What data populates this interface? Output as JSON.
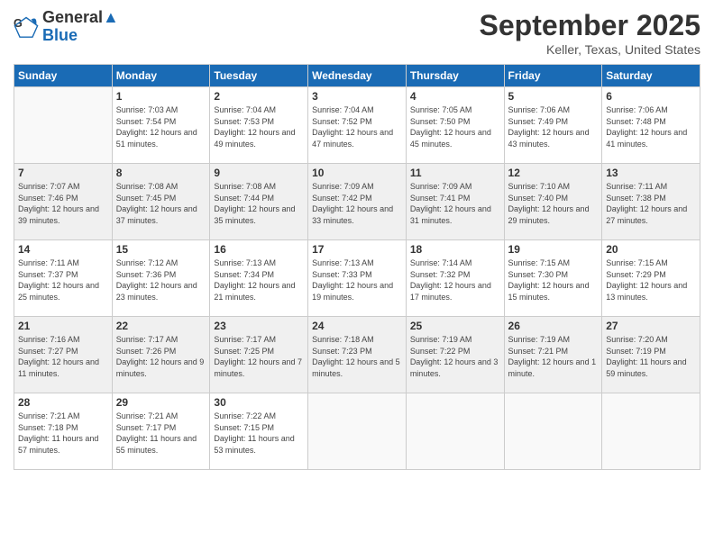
{
  "logo": {
    "line1": "General",
    "line2": "Blue"
  },
  "header": {
    "month": "September 2025",
    "location": "Keller, Texas, United States"
  },
  "weekdays": [
    "Sunday",
    "Monday",
    "Tuesday",
    "Wednesday",
    "Thursday",
    "Friday",
    "Saturday"
  ],
  "weeks": [
    [
      {
        "day": "",
        "sunrise": "",
        "sunset": "",
        "daylight": ""
      },
      {
        "day": "1",
        "sunrise": "Sunrise: 7:03 AM",
        "sunset": "Sunset: 7:54 PM",
        "daylight": "Daylight: 12 hours and 51 minutes."
      },
      {
        "day": "2",
        "sunrise": "Sunrise: 7:04 AM",
        "sunset": "Sunset: 7:53 PM",
        "daylight": "Daylight: 12 hours and 49 minutes."
      },
      {
        "day": "3",
        "sunrise": "Sunrise: 7:04 AM",
        "sunset": "Sunset: 7:52 PM",
        "daylight": "Daylight: 12 hours and 47 minutes."
      },
      {
        "day": "4",
        "sunrise": "Sunrise: 7:05 AM",
        "sunset": "Sunset: 7:50 PM",
        "daylight": "Daylight: 12 hours and 45 minutes."
      },
      {
        "day": "5",
        "sunrise": "Sunrise: 7:06 AM",
        "sunset": "Sunset: 7:49 PM",
        "daylight": "Daylight: 12 hours and 43 minutes."
      },
      {
        "day": "6",
        "sunrise": "Sunrise: 7:06 AM",
        "sunset": "Sunset: 7:48 PM",
        "daylight": "Daylight: 12 hours and 41 minutes."
      }
    ],
    [
      {
        "day": "7",
        "sunrise": "Sunrise: 7:07 AM",
        "sunset": "Sunset: 7:46 PM",
        "daylight": "Daylight: 12 hours and 39 minutes."
      },
      {
        "day": "8",
        "sunrise": "Sunrise: 7:08 AM",
        "sunset": "Sunset: 7:45 PM",
        "daylight": "Daylight: 12 hours and 37 minutes."
      },
      {
        "day": "9",
        "sunrise": "Sunrise: 7:08 AM",
        "sunset": "Sunset: 7:44 PM",
        "daylight": "Daylight: 12 hours and 35 minutes."
      },
      {
        "day": "10",
        "sunrise": "Sunrise: 7:09 AM",
        "sunset": "Sunset: 7:42 PM",
        "daylight": "Daylight: 12 hours and 33 minutes."
      },
      {
        "day": "11",
        "sunrise": "Sunrise: 7:09 AM",
        "sunset": "Sunset: 7:41 PM",
        "daylight": "Daylight: 12 hours and 31 minutes."
      },
      {
        "day": "12",
        "sunrise": "Sunrise: 7:10 AM",
        "sunset": "Sunset: 7:40 PM",
        "daylight": "Daylight: 12 hours and 29 minutes."
      },
      {
        "day": "13",
        "sunrise": "Sunrise: 7:11 AM",
        "sunset": "Sunset: 7:38 PM",
        "daylight": "Daylight: 12 hours and 27 minutes."
      }
    ],
    [
      {
        "day": "14",
        "sunrise": "Sunrise: 7:11 AM",
        "sunset": "Sunset: 7:37 PM",
        "daylight": "Daylight: 12 hours and 25 minutes."
      },
      {
        "day": "15",
        "sunrise": "Sunrise: 7:12 AM",
        "sunset": "Sunset: 7:36 PM",
        "daylight": "Daylight: 12 hours and 23 minutes."
      },
      {
        "day": "16",
        "sunrise": "Sunrise: 7:13 AM",
        "sunset": "Sunset: 7:34 PM",
        "daylight": "Daylight: 12 hours and 21 minutes."
      },
      {
        "day": "17",
        "sunrise": "Sunrise: 7:13 AM",
        "sunset": "Sunset: 7:33 PM",
        "daylight": "Daylight: 12 hours and 19 minutes."
      },
      {
        "day": "18",
        "sunrise": "Sunrise: 7:14 AM",
        "sunset": "Sunset: 7:32 PM",
        "daylight": "Daylight: 12 hours and 17 minutes."
      },
      {
        "day": "19",
        "sunrise": "Sunrise: 7:15 AM",
        "sunset": "Sunset: 7:30 PM",
        "daylight": "Daylight: 12 hours and 15 minutes."
      },
      {
        "day": "20",
        "sunrise": "Sunrise: 7:15 AM",
        "sunset": "Sunset: 7:29 PM",
        "daylight": "Daylight: 12 hours and 13 minutes."
      }
    ],
    [
      {
        "day": "21",
        "sunrise": "Sunrise: 7:16 AM",
        "sunset": "Sunset: 7:27 PM",
        "daylight": "Daylight: 12 hours and 11 minutes."
      },
      {
        "day": "22",
        "sunrise": "Sunrise: 7:17 AM",
        "sunset": "Sunset: 7:26 PM",
        "daylight": "Daylight: 12 hours and 9 minutes."
      },
      {
        "day": "23",
        "sunrise": "Sunrise: 7:17 AM",
        "sunset": "Sunset: 7:25 PM",
        "daylight": "Daylight: 12 hours and 7 minutes."
      },
      {
        "day": "24",
        "sunrise": "Sunrise: 7:18 AM",
        "sunset": "Sunset: 7:23 PM",
        "daylight": "Daylight: 12 hours and 5 minutes."
      },
      {
        "day": "25",
        "sunrise": "Sunrise: 7:19 AM",
        "sunset": "Sunset: 7:22 PM",
        "daylight": "Daylight: 12 hours and 3 minutes."
      },
      {
        "day": "26",
        "sunrise": "Sunrise: 7:19 AM",
        "sunset": "Sunset: 7:21 PM",
        "daylight": "Daylight: 12 hours and 1 minute."
      },
      {
        "day": "27",
        "sunrise": "Sunrise: 7:20 AM",
        "sunset": "Sunset: 7:19 PM",
        "daylight": "Daylight: 11 hours and 59 minutes."
      }
    ],
    [
      {
        "day": "28",
        "sunrise": "Sunrise: 7:21 AM",
        "sunset": "Sunset: 7:18 PM",
        "daylight": "Daylight: 11 hours and 57 minutes."
      },
      {
        "day": "29",
        "sunrise": "Sunrise: 7:21 AM",
        "sunset": "Sunset: 7:17 PM",
        "daylight": "Daylight: 11 hours and 55 minutes."
      },
      {
        "day": "30",
        "sunrise": "Sunrise: 7:22 AM",
        "sunset": "Sunset: 7:15 PM",
        "daylight": "Daylight: 11 hours and 53 minutes."
      },
      {
        "day": "",
        "sunrise": "",
        "sunset": "",
        "daylight": ""
      },
      {
        "day": "",
        "sunrise": "",
        "sunset": "",
        "daylight": ""
      },
      {
        "day": "",
        "sunrise": "",
        "sunset": "",
        "daylight": ""
      },
      {
        "day": "",
        "sunrise": "",
        "sunset": "",
        "daylight": ""
      }
    ]
  ]
}
